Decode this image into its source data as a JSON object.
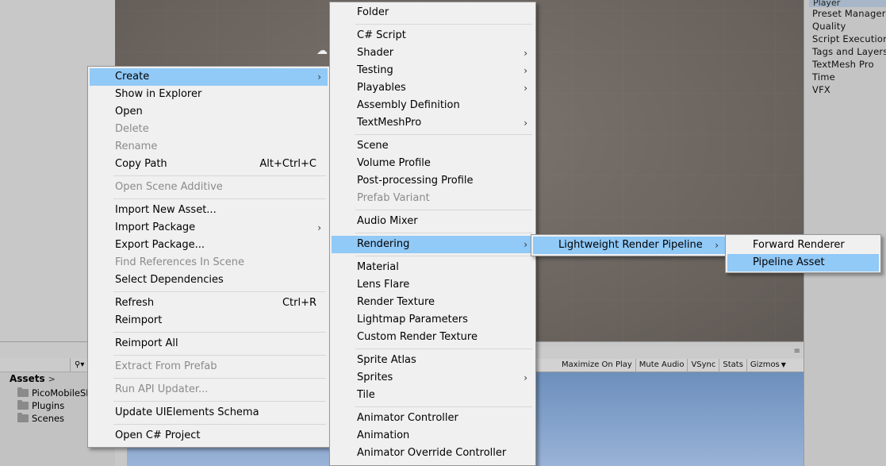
{
  "project_settings": {
    "top_item": "Player",
    "items": [
      "Preset Manager",
      "Quality",
      "Script Execution",
      "Tags and Layers",
      "TextMesh Pro",
      "Time",
      "VFX"
    ]
  },
  "assets_panel": {
    "breadcrumb": "Assets",
    "folders": [
      "PicoMobileSDK",
      "Plugins",
      "Scenes"
    ]
  },
  "game_toolbar": {
    "maximize_on_play": "Maximize On Play",
    "mute_audio": "Mute Audio",
    "vsync": "VSync",
    "stats": "Stats",
    "gizmos": "Gizmos"
  },
  "context_menu": {
    "create": "Create",
    "show_in_explorer": "Show in Explorer",
    "open": "Open",
    "delete": "Delete",
    "rename": "Rename",
    "copy_path": "Copy Path",
    "copy_path_shortcut": "Alt+Ctrl+C",
    "open_scene_additive": "Open Scene Additive",
    "import_new_asset": "Import New Asset...",
    "import_package": "Import Package",
    "export_package": "Export Package...",
    "find_references": "Find References In Scene",
    "select_dependencies": "Select Dependencies",
    "refresh": "Refresh",
    "refresh_shortcut": "Ctrl+R",
    "reimport": "Reimport",
    "reimport_all": "Reimport All",
    "extract_from_prefab": "Extract From Prefab",
    "run_api_updater": "Run API Updater...",
    "update_uielements_schema": "Update UIElements Schema",
    "open_csharp_project": "Open C# Project"
  },
  "create_menu": {
    "folder": "Folder",
    "csharp_script": "C# Script",
    "shader": "Shader",
    "testing": "Testing",
    "playables": "Playables",
    "assembly_definition": "Assembly Definition",
    "textmeshpro": "TextMeshPro",
    "scene": "Scene",
    "volume_profile": "Volume Profile",
    "postprocessing_profile": "Post-processing Profile",
    "prefab_variant": "Prefab Variant",
    "audio_mixer": "Audio Mixer",
    "rendering": "Rendering",
    "material": "Material",
    "lens_flare": "Lens Flare",
    "render_texture": "Render Texture",
    "lightmap_parameters": "Lightmap Parameters",
    "custom_render_texture": "Custom Render Texture",
    "sprite_atlas": "Sprite Atlas",
    "sprites": "Sprites",
    "tile": "Tile",
    "animator_controller": "Animator Controller",
    "animation": "Animation",
    "animator_override_controller": "Animator Override Controller"
  },
  "rendering_menu": {
    "lwrp": "Lightweight Render Pipeline"
  },
  "lwrp_menu": {
    "forward_renderer": "Forward Renderer",
    "pipeline_asset": "Pipeline Asset"
  }
}
